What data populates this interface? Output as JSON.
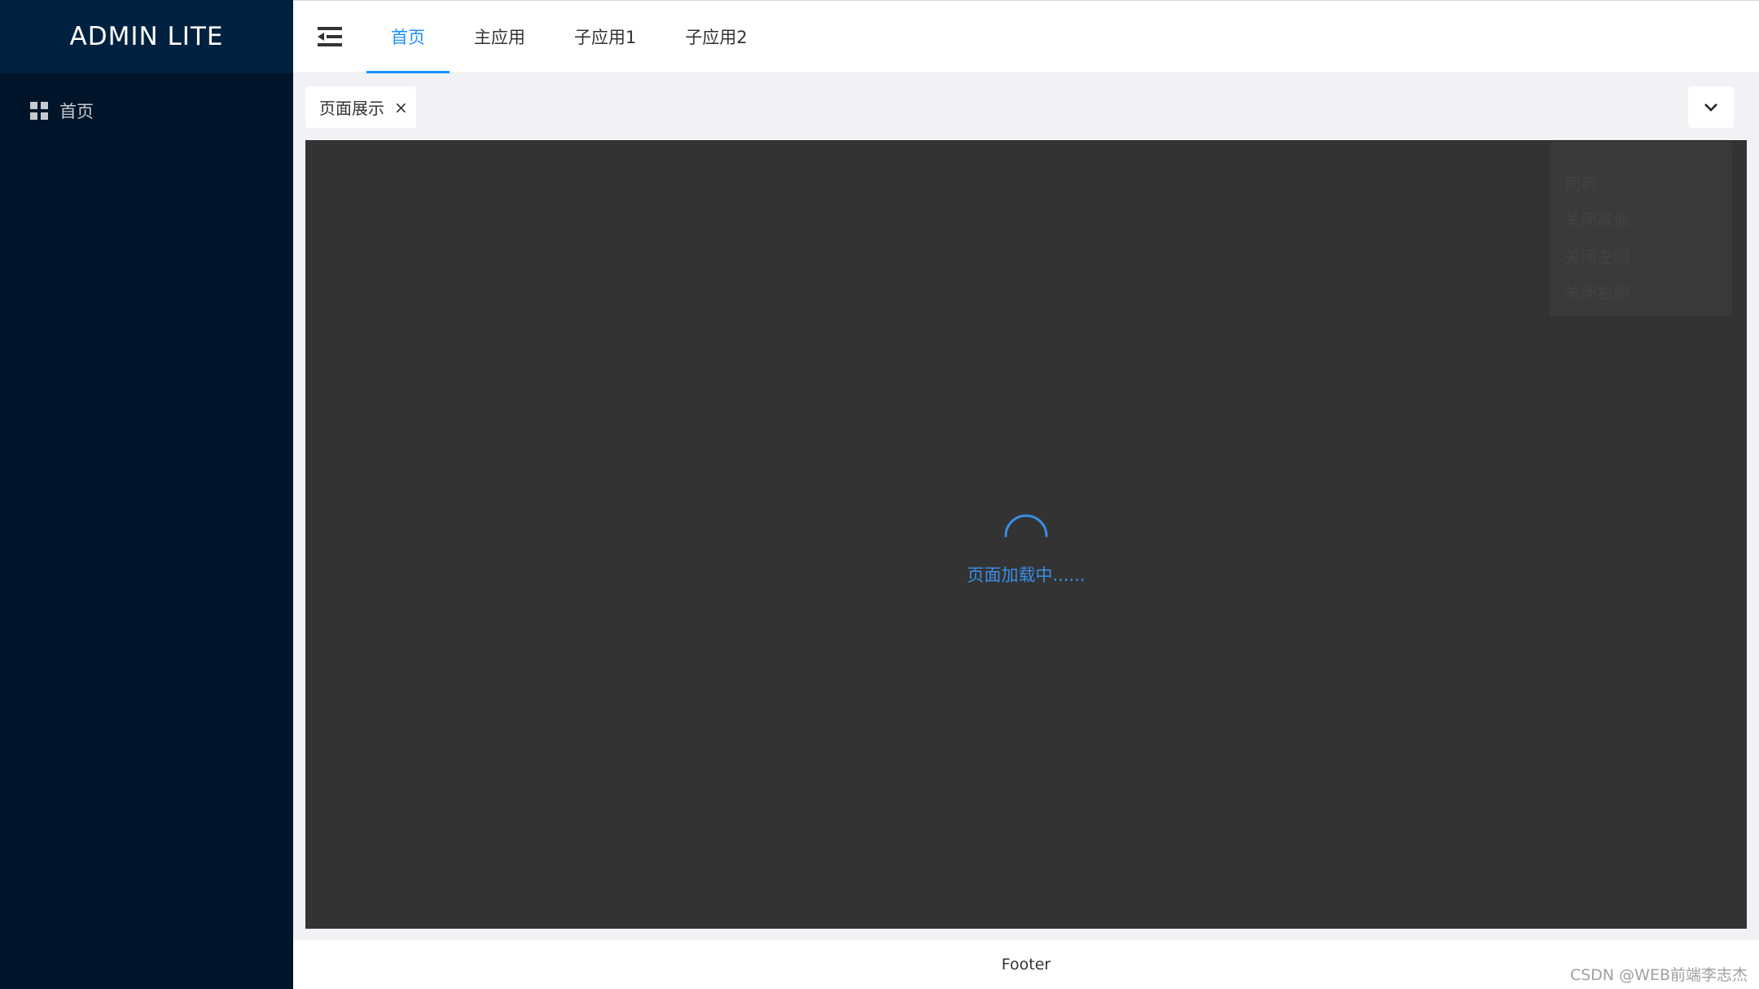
{
  "sidebar": {
    "logo": "ADMIN LITE",
    "items": [
      {
        "label": "首页",
        "icon": "grid-icon"
      }
    ]
  },
  "header": {
    "collapse_icon": "menu-fold-icon",
    "tabs": [
      {
        "label": "首页",
        "active": true
      },
      {
        "label": "主应用",
        "active": false
      },
      {
        "label": "子应用1",
        "active": false
      },
      {
        "label": "子应用2",
        "active": false
      }
    ]
  },
  "tags": {
    "items": [
      {
        "label": "页面展示",
        "close": "×"
      }
    ],
    "dropdown_icon": "chevron-down-icon",
    "menu": [
      "刷新",
      "关闭其他",
      "关闭左侧",
      "关闭右侧"
    ]
  },
  "content": {
    "loading_text": "页面加载中......"
  },
  "footer": {
    "text": "Footer"
  },
  "watermark": "CSDN @WEB前端李志杰",
  "colors": {
    "sidebar_bg": "#001529",
    "logo_bg": "#002140",
    "accent": "#1890ff",
    "content_bg": "#333333"
  }
}
